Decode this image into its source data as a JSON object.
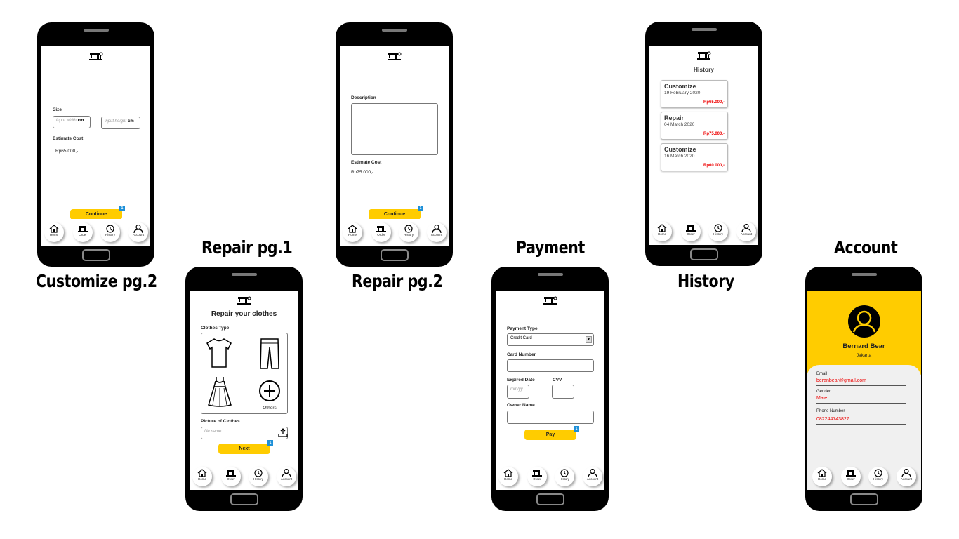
{
  "captions": {
    "customize2": "Customize pg.2",
    "repair1": "Repair pg.1",
    "repair2": "Repair pg.2",
    "payment": "Payment",
    "history": "History",
    "account": "Account"
  },
  "nav": {
    "home": "Home",
    "order": "Order",
    "history": "History",
    "account": "Account"
  },
  "customize2": {
    "size_label": "Size",
    "width_placeholder": "input width",
    "height_placeholder": "input height",
    "unit": "cm",
    "estimate_label": "Estimate Cost",
    "estimate_value": "Rp65.000,-",
    "continue_label": "Continue",
    "badge": "1"
  },
  "repair1": {
    "title": "Repair your clothes",
    "type_label": "Clothes Type",
    "others_label": "Others",
    "picture_label": "Picture of Clothes",
    "file_placeholder": "file name",
    "next_label": "Next",
    "badge": "1"
  },
  "repair2": {
    "description_label": "Description",
    "estimate_label": "Estimate Cost",
    "estimate_value": "Rp75.000,-",
    "continue_label": "Continue",
    "badge": "1"
  },
  "payment": {
    "type_label": "Payment Type",
    "type_value": "Credit Card",
    "card_label": "Card Number",
    "expired_label": "Expired Date",
    "expired_placeholder": "mm/yy",
    "cvv_label": "CVV",
    "owner_label": "Owner Name",
    "pay_label": "Pay",
    "badge": "1"
  },
  "history": {
    "title": "History",
    "items": [
      {
        "title": "Customize",
        "date": "19 February 2020",
        "price": "Rp65.000,-"
      },
      {
        "title": "Repair",
        "date": "04 March 2020",
        "price": "Rp75.000,-"
      },
      {
        "title": "Customize",
        "date": "16 March 2020",
        "price": "Rp60.000,-"
      }
    ]
  },
  "account": {
    "name": "Bernard Bear",
    "city": "Jakarta",
    "fields": [
      {
        "label": "Email",
        "value": "beranbear@gmail.com"
      },
      {
        "label": "Gender",
        "value": "Male"
      },
      {
        "label": "Phone Number",
        "value": "082244743827"
      }
    ]
  },
  "colors": {
    "accent": "#ffcc00",
    "badge": "#1e90d8",
    "price": "#ee0000"
  },
  "icons": [
    "sewing-machine-icon",
    "home-icon",
    "history-icon",
    "user-icon",
    "tshirt-icon",
    "pants-icon",
    "dress-icon",
    "plus-circle-icon",
    "upload-icon",
    "dropdown-arrow-icon"
  ]
}
